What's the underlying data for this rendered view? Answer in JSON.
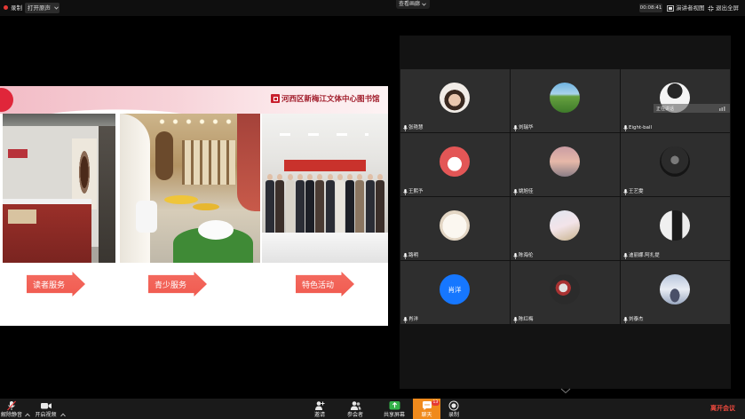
{
  "top_bar": {
    "recording_label": "录制",
    "original_sound_button": "打开原声",
    "view_menu": "查看画廊",
    "timer": "00:08:41",
    "speaker_view_button": "演讲者视图",
    "exit_fullscreen_button": "退出全屏"
  },
  "shared_slide": {
    "title": "河西区新梅江文体中心图书馆",
    "labels": [
      "读者服务",
      "青少服务",
      "特色活动"
    ]
  },
  "gallery": {
    "speaking_label": "正在讲话",
    "participants": [
      {
        "name": "张艳慧",
        "mic_icon": "mic-icon"
      },
      {
        "name": "刘瑞华",
        "mic_icon": "mic-icon"
      },
      {
        "name": "Eight-ball",
        "mic_icon": "mic-icon"
      },
      {
        "name": "王熙予",
        "mic_icon": "mic-icon"
      },
      {
        "name": "姚旭佳",
        "mic_icon": "mic-icon"
      },
      {
        "name": "王艺雯",
        "mic_icon": "mic-icon"
      },
      {
        "name": "路明",
        "mic_icon": "mic-icon"
      },
      {
        "name": "陈海伦",
        "mic_icon": "mic-icon"
      },
      {
        "name": "迪丽娜.阿扎提",
        "mic_icon": "mic-icon"
      },
      {
        "name": "肖洋",
        "mic_icon": "mic-icon",
        "avatar_text": "肖洋"
      },
      {
        "name": "陈红梅",
        "mic_icon": "mic-icon"
      },
      {
        "name": "刘泰杰",
        "mic_icon": "mic-icon"
      }
    ]
  },
  "toolbar": {
    "unmute": {
      "label": "解除静音",
      "icon": "mic-off-icon"
    },
    "start_video": {
      "label": "开启视频",
      "icon": "video-icon"
    },
    "invite": {
      "label": "邀请",
      "icon": "invite-icon"
    },
    "participants": {
      "label": "参会者",
      "icon": "participants-icon"
    },
    "share_screen": {
      "label": "共享屏幕",
      "icon": "share-screen-icon"
    },
    "chat": {
      "label": "聊天",
      "icon": "chat-icon",
      "badge": "13"
    },
    "record": {
      "label": "录制",
      "icon": "record-icon"
    },
    "leave": {
      "label": "离开会议"
    }
  },
  "colors": {
    "chat_highlight": "#f08a1c",
    "leave_text": "#f04a3e",
    "share_screen_green": "#34b24a",
    "slide_arrow": "#f05b50",
    "slide_title": "#a11d2b",
    "avatar_blue": "#1677ff"
  }
}
